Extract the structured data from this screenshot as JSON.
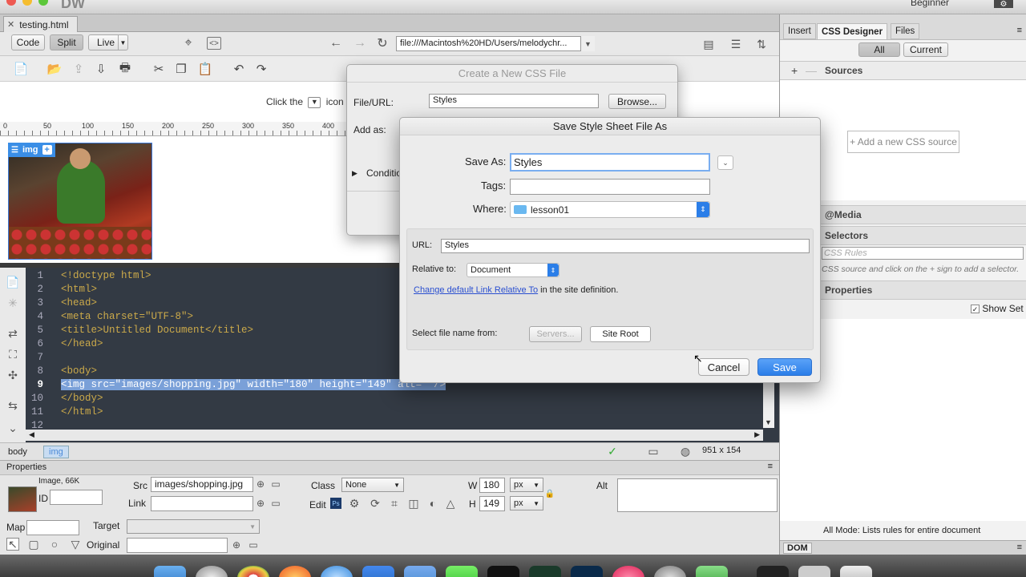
{
  "app": {
    "name": "DW",
    "workspace": "Beginner"
  },
  "document": {
    "tab_name": "testing.html",
    "view_buttons": {
      "code": "Code",
      "split": "Split",
      "live": "Live"
    },
    "url": "file:///Macintosh%20HD/Users/melodychr...",
    "hint_text": "Click the",
    "hint_text_2": "icon c",
    "ruler_ticks": [
      "0",
      "50",
      "100",
      "150",
      "200",
      "250",
      "300",
      "350",
      "400"
    ],
    "element_tag": "img"
  },
  "code_lines": [
    {
      "num": "1",
      "text": "<!doctype html>"
    },
    {
      "num": "2",
      "text": "<html>"
    },
    {
      "num": "3",
      "text": "<head>"
    },
    {
      "num": "4",
      "text": "<meta charset=\"UTF-8\">"
    },
    {
      "num": "5",
      "text": "<title>Untitled Document</title>"
    },
    {
      "num": "6",
      "text": "</head>"
    },
    {
      "num": "7",
      "text": ""
    },
    {
      "num": "8",
      "text": "<body>"
    },
    {
      "num": "9",
      "text": "<img src=\"images/shopping.jpg\" width=\"180\" height=\"149\" alt=\"\"/>"
    },
    {
      "num": "10",
      "text": "</body>"
    },
    {
      "num": "11",
      "text": "</html>"
    },
    {
      "num": "12",
      "text": ""
    }
  ],
  "tag_selector": {
    "body": "body",
    "img": "img",
    "size": "951 x 154"
  },
  "properties": {
    "title": "Properties",
    "kind": "Image, 66K",
    "id_label": "ID",
    "src_label": "Src",
    "src_value": "images/shopping.jpg",
    "link_label": "Link",
    "class_label": "Class",
    "class_value": "None",
    "edit_label": "Edit",
    "w_label": "W",
    "w_value": "180",
    "w_unit": "px",
    "h_label": "H",
    "h_value": "149",
    "h_unit": "px",
    "alt_label": "Alt",
    "map_label": "Map",
    "target_label": "Target",
    "original_label": "Original"
  },
  "right_panel": {
    "tabs": [
      "Insert",
      "CSS Designer",
      "Files"
    ],
    "toggle_all": "All",
    "toggle_current": "Current",
    "sources_label": "Sources",
    "add_source": "+ Add a new CSS source",
    "media_label": "@Media",
    "selectors_label": "Selectors",
    "selector_placeholder": "CSS Rules",
    "selector_help": "CSS source and click on the + sign to add a selector.",
    "properties_label": "Properties",
    "show_set": "Show Set",
    "mode_text": "All Mode: Lists rules for entire document",
    "dom_tab": "DOM"
  },
  "dialog_css": {
    "title": "Create a New CSS File",
    "file_url_label": "File/URL:",
    "file_url_value": "Styles",
    "browse": "Browse...",
    "add_as": "Add as:",
    "conditional": "Conditio"
  },
  "dialog_save": {
    "title": "Save Style Sheet File As",
    "save_as_label": "Save As:",
    "save_as_value": "Styles",
    "tags_label": "Tags:",
    "where_label": "Where:",
    "where_value": "lesson01",
    "url_label": "URL:",
    "url_value": "Styles",
    "relative_label": "Relative to:",
    "relative_value": "Document",
    "link_text": "Change default Link Relative To",
    "link_suffix": " in the site definition.",
    "select_from": "Select file name from:",
    "servers": "Servers...",
    "site_root": "Site Root",
    "cancel": "Cancel",
    "save": "Save"
  },
  "colors": {
    "accent": "#2b7ee8",
    "code_bg": "#333a44",
    "tag_blue": "#3a8ee6"
  }
}
